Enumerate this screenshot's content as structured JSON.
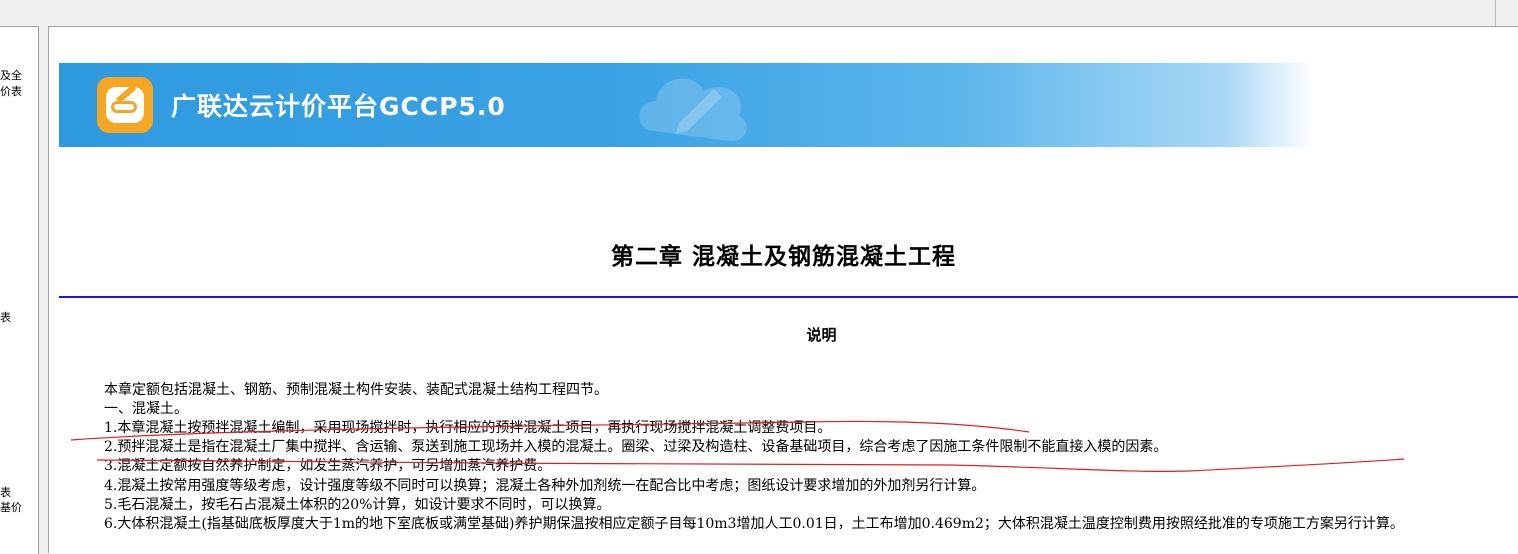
{
  "left_panel": {
    "items": [
      "及全",
      "价表",
      "表",
      "表",
      "基价"
    ]
  },
  "banner": {
    "title": "广联达云计价平台GCCP5.0",
    "logo_icon": "cloud-pen-logo-icon",
    "accent_color": "#3aa2e4",
    "logo_color": "#f5a623"
  },
  "document": {
    "chapter_title": "第二章  混凝土及钢筋混凝土工程",
    "section_title": "说明",
    "paragraphs": [
      "本章定额包括混凝土、钢筋、预制混凝土构件安装、装配式混凝土结构工程四节。",
      "一、混凝土。",
      "1.本章混凝土按预拌混凝土编制，采用现场搅拌时，执行相应的预拌混凝土项目，再执行现场搅拌混凝土调整费项目。",
      "2.预拌混凝土是指在混凝土厂集中搅拌、含运输、泵送到施工现场并入模的混凝土。圈梁、过梁及构造柱、设备基础项目，综合考虑了因施工条件限制不能直接入模的因素。",
      "3.混凝土定额按自然养护制定，如发生蒸汽养护，可另增加蒸汽养护费。",
      "4.混凝土按常用强度等级考虑，设计强度等级不同时可以换算；混凝土各种外加剂统一在配合比中考虑；图纸设计要求增加的外加剂另行计算。",
      "5.毛石混凝土，按毛石占混凝土体积的20%计算，如设计要求不同时，可以换算。",
      "6.大体积混凝土(指基础底板厚度大于1m的地下室底板或满堂基础)养护期保温按相应定额子目每10m3增加人工0.01日，土工布增加0.469m2；大体积混凝土温度控制费用按照经批准的专项施工方案另行计算。"
    ],
    "rule_color": "#1a1ac8",
    "annotation_color": "#e02020"
  }
}
